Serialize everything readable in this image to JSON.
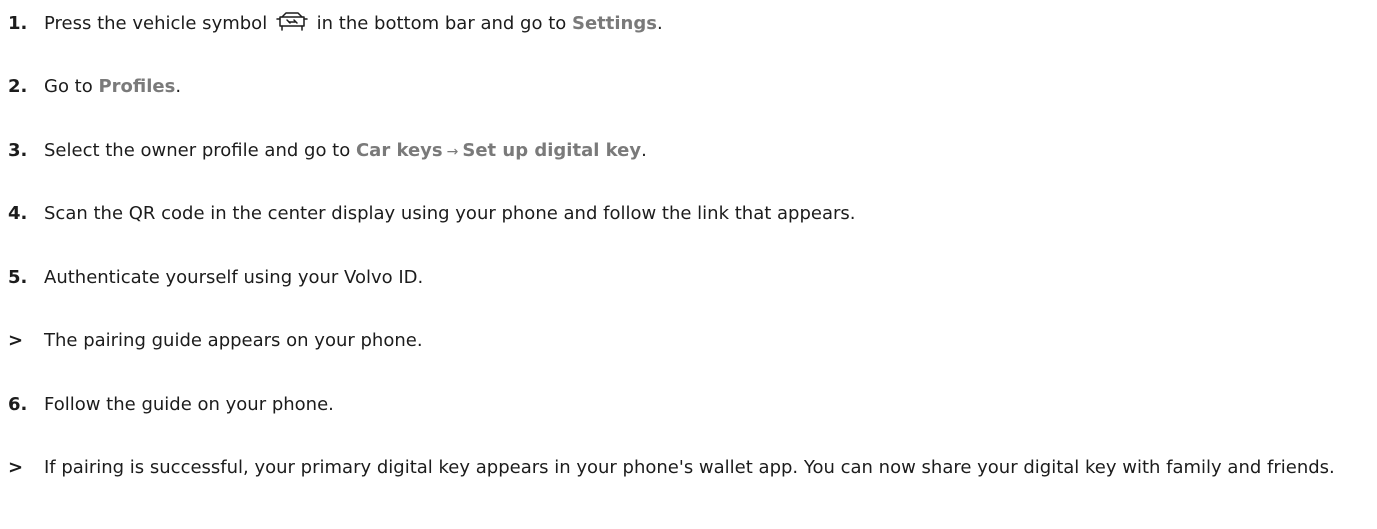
{
  "steps": [
    {
      "marker": "1.",
      "before": "Press the vehicle symbol",
      "icon": "car-icon",
      "after": " in the bottom bar and go to ",
      "ui1": "Settings",
      "end": "."
    },
    {
      "marker": "2.",
      "before": "Go to ",
      "ui1": "Profiles",
      "end": "."
    },
    {
      "marker": "3.",
      "before": "Select the owner profile and go to ",
      "ui1": "Car keys",
      "arrow": "→",
      "ui2": "Set up digital key",
      "end": "."
    },
    {
      "marker": "4.",
      "text": "Scan the QR code in the center display using your phone and follow the link that appears."
    },
    {
      "marker": "5.",
      "text": "Authenticate yourself using your Volvo ID."
    },
    {
      "marker": ">",
      "text": "The pairing guide appears on your phone."
    },
    {
      "marker": "6.",
      "text": "Follow the guide on your phone."
    },
    {
      "marker": ">",
      "text": "If pairing is successful, your primary digital key appears in your phone's wallet app. You can now share your digital key with family and friends."
    }
  ]
}
